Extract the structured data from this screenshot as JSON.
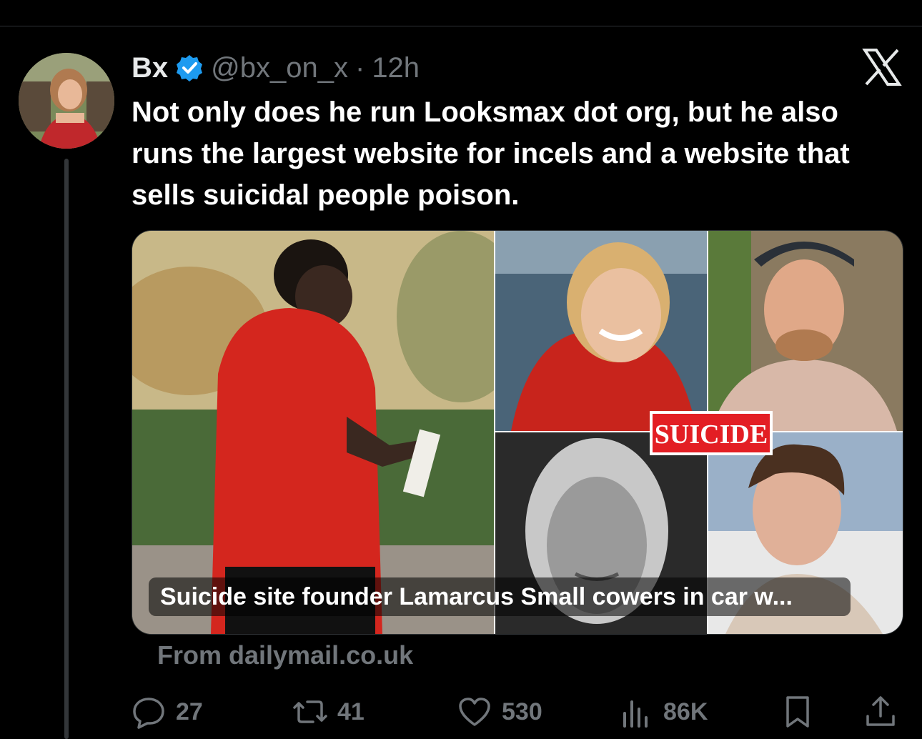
{
  "tweet": {
    "author_name": "Bx",
    "handle": "@bx_on_x",
    "separator": "·",
    "time": "12h",
    "text": "Not only does he run Looksmax dot org, but he also runs the largest website for incels and a website that sells suicidal people poison.",
    "verified": true
  },
  "card": {
    "headline": "Suicide site founder Lamarcus Small cowers in car w...",
    "badge": "SUICIDE",
    "source_prefix": "From ",
    "source_domain": "dailymail.co.uk"
  },
  "actions": {
    "replies": "27",
    "reposts": "41",
    "likes": "530",
    "views": "86K"
  },
  "colors": {
    "background": "#000000",
    "text_primary": "#e7e9ea",
    "text_secondary": "#71767b",
    "verified_blue": "#1d9bf0",
    "badge_red": "#e31e24"
  },
  "icons": [
    "verified-badge-icon",
    "x-logo-icon",
    "reply-icon",
    "repost-icon",
    "like-icon",
    "views-icon",
    "bookmark-icon",
    "share-icon"
  ]
}
